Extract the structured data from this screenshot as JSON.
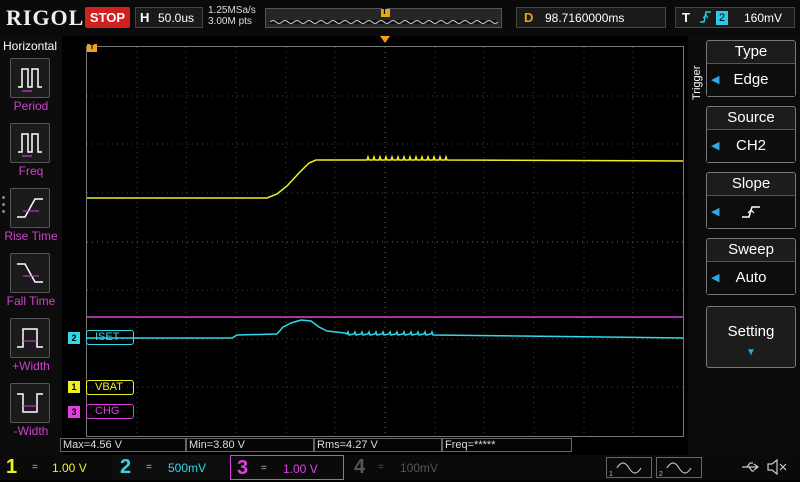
{
  "brand": "RIGOL",
  "run_state": "STOP",
  "timebase": {
    "letter": "H",
    "value": "50.0us"
  },
  "sampling": {
    "rate": "1.25MSa/s",
    "points": "3.00M pts"
  },
  "delay": {
    "letter": "D",
    "value": "98.7160000ms"
  },
  "trigger_status": {
    "letter": "T",
    "channel": "2",
    "level": "160mV",
    "edge_icon": "rising-edge-icon"
  },
  "left_menu": {
    "title": "Horizontal",
    "items": [
      {
        "label": "Period"
      },
      {
        "label": "Freq"
      },
      {
        "label": "Rise Time"
      },
      {
        "label": "Fall Time"
      },
      {
        "label": "+Width"
      },
      {
        "label": "-Width"
      }
    ]
  },
  "trigger_menu": {
    "title": "Trigger",
    "sections": [
      {
        "title": "Type",
        "value": "Edge"
      },
      {
        "title": "Source",
        "value": "CH2"
      },
      {
        "title": "Slope",
        "value": ""
      },
      {
        "title": "Sweep",
        "value": "Auto"
      }
    ],
    "setting_label": "Setting"
  },
  "channel_labels": {
    "ch2": {
      "num": "2",
      "text": "ISET"
    },
    "ch1": {
      "num": "1",
      "text": "VBAT"
    },
    "ch3": {
      "num": "3",
      "text": "CHG"
    }
  },
  "markers": {
    "trigger_pos": "T",
    "trigger_level": "T"
  },
  "measurements": {
    "max": "Max=4.56 V",
    "min": "Min=3.80 V",
    "rms": "Rms=4.27 V",
    "freq": "Freq=*****"
  },
  "channels": [
    {
      "num": "1",
      "coupling": "=",
      "scale": "1.00 V",
      "color": "#f0f020"
    },
    {
      "num": "2",
      "coupling": "=",
      "scale": "500mV",
      "color": "#30d8e8"
    },
    {
      "num": "3",
      "coupling": "=",
      "scale": "1.00 V",
      "color": "#e040e0"
    },
    {
      "num": "4",
      "coupling": "=",
      "scale": "100mV",
      "color": "#555555"
    }
  ],
  "colors": {
    "ch1": "#f0f020",
    "ch2": "#30d8e8",
    "ch3": "#e040e0",
    "accent": "#f0a020",
    "stop": "#d02020"
  }
}
